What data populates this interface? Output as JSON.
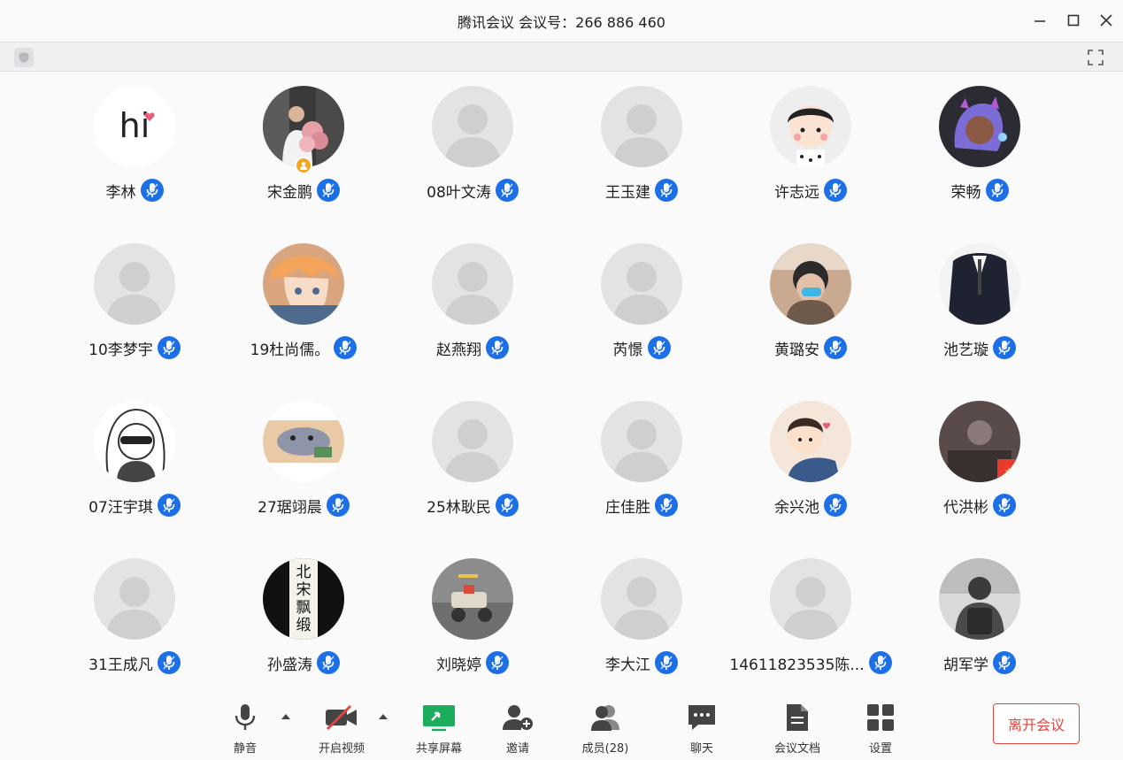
{
  "window": {
    "title": "腾讯会议 会议号：266 886 460"
  },
  "participants": [
    {
      "name": "李林",
      "avatar": "hi-text"
    },
    {
      "name": "宋金鹏",
      "avatar": "photo-flowers",
      "host": true
    },
    {
      "name": "08叶文涛",
      "avatar": "default"
    },
    {
      "name": "王玉建",
      "avatar": "default"
    },
    {
      "name": "许志远",
      "avatar": "cartoon-girl"
    },
    {
      "name": "荣畅",
      "avatar": "anime-purple"
    },
    {
      "name": "10李梦宇",
      "avatar": "default"
    },
    {
      "name": "19杜尚儒。",
      "avatar": "anime-orange"
    },
    {
      "name": "赵燕翔",
      "avatar": "default"
    },
    {
      "name": "芮憬",
      "avatar": "default"
    },
    {
      "name": "黄璐安",
      "avatar": "photo-mask"
    },
    {
      "name": "池艺璇",
      "avatar": "photo-suit"
    },
    {
      "name": "07汪宇琪",
      "avatar": "sketch-girl"
    },
    {
      "name": "27琚翊晨",
      "avatar": "cartoon-cat"
    },
    {
      "name": "25林耿民",
      "avatar": "default"
    },
    {
      "name": "庄佳胜",
      "avatar": "default"
    },
    {
      "name": "余兴池",
      "avatar": "cartoon-hug"
    },
    {
      "name": "代洪彬",
      "avatar": "photo-dark"
    },
    {
      "name": "31王成凡",
      "avatar": "default"
    },
    {
      "name": "孙盛涛",
      "avatar": "calligraphy"
    },
    {
      "name": "刘晓婷",
      "avatar": "photo-bike"
    },
    {
      "name": "李大江",
      "avatar": "default"
    },
    {
      "name": "14611823535陈...",
      "avatar": "default"
    },
    {
      "name": "胡军学",
      "avatar": "photo-backpack"
    }
  ],
  "calligraphy_text": "北宋飘缎",
  "toolbar": {
    "mute": "静音",
    "video": "开启视频",
    "share": "共享屏幕",
    "invite": "邀请",
    "members": "成员(28)",
    "chat": "聊天",
    "docs": "会议文档",
    "settings": "设置",
    "leave": "离开会议"
  },
  "colors": {
    "accent": "#1d6fe8",
    "leave": "#e0453f",
    "share_green": "#1aad5b",
    "video_off_red": "#e0453f"
  }
}
